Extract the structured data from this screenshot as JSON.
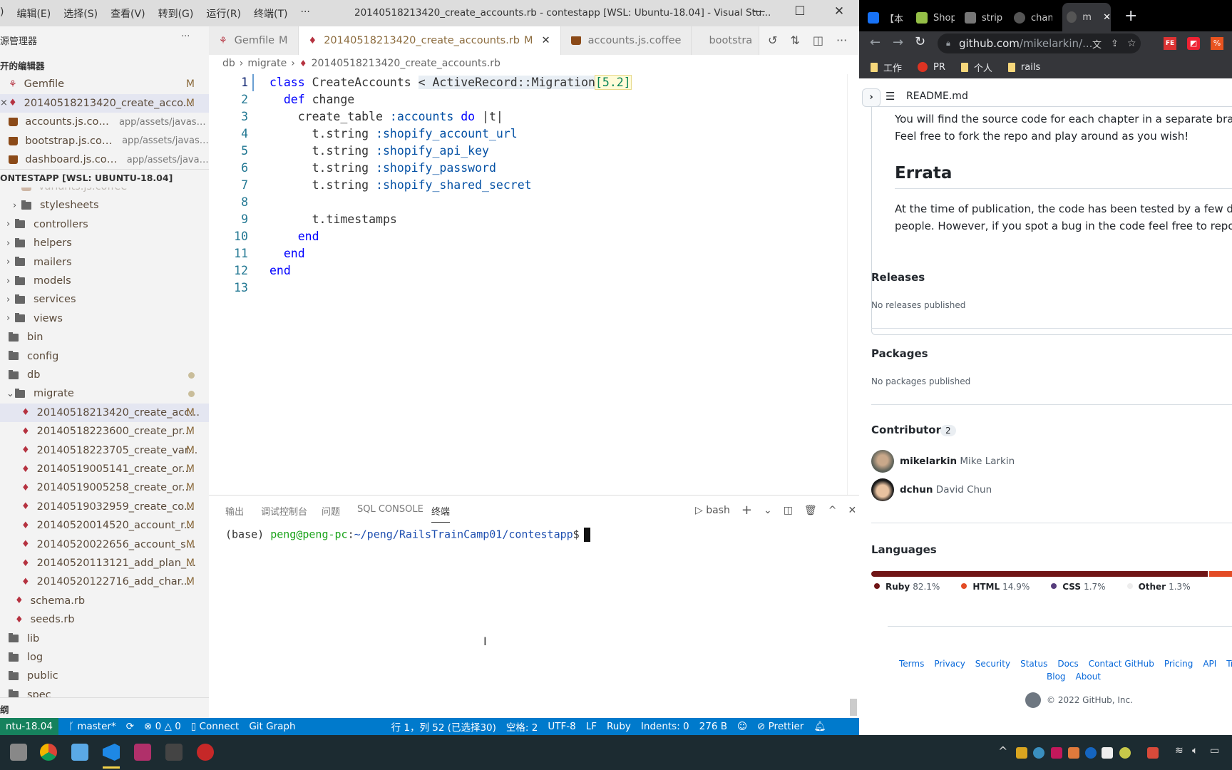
{
  "vscode": {
    "menu": [
      ")",
      "编辑(E)",
      "选择(S)",
      "查看(V)",
      "转到(G)",
      "运行(R)",
      "终端(T)",
      "···"
    ],
    "window_title": "20140518213420_create_accounts.rb - contestapp [WSL: Ubuntu-18.04] - Visual Stu...",
    "window_buttons": {
      "minimize": "—",
      "maximize": "☐",
      "close": "✕"
    },
    "sidebar": {
      "title": "源管理器",
      "more": "···",
      "open_editors_header": "开的编辑器",
      "open_editors": [
        {
          "label": "Gemfile",
          "icon": "gem-icon",
          "badge": "M"
        },
        {
          "label": "20140518213420_create_acco...",
          "icon": "ruby-icon",
          "badge": "M",
          "close": "×",
          "selected": true
        },
        {
          "label": "accounts.js.coffee",
          "icon": "coffee-icon",
          "desc": "app/assets/javascr..."
        },
        {
          "label": "bootstrap.js.coffee",
          "icon": "coffee-icon",
          "desc": "app/assets/javasc..."
        },
        {
          "label": "dashboard.js.coffee",
          "icon": "coffee-icon",
          "desc": "app/assets/javas..."
        }
      ],
      "workspace_header": "ONTESTAPP [WSL: UBUNTU-18.04]",
      "tree": [
        {
          "label": "variants.js.coffee",
          "type": "file",
          "depth": 2,
          "faded": true
        },
        {
          "label": "stylesheets",
          "type": "folder",
          "depth": 2,
          "chevron": ">"
        },
        {
          "label": "controllers",
          "type": "folder",
          "depth": 1,
          "chevron": ">"
        },
        {
          "label": "helpers",
          "type": "folder",
          "depth": 1,
          "chevron": ">"
        },
        {
          "label": "mailers",
          "type": "folder",
          "depth": 1,
          "chevron": ">"
        },
        {
          "label": "models",
          "type": "folder",
          "depth": 1,
          "chevron": ">"
        },
        {
          "label": "services",
          "type": "folder",
          "depth": 1,
          "chevron": ">"
        },
        {
          "label": "views",
          "type": "folder",
          "depth": 1,
          "chevron": ">"
        },
        {
          "label": "bin",
          "type": "folder",
          "depth": 0
        },
        {
          "label": "config",
          "type": "folder",
          "depth": 0
        },
        {
          "label": "db",
          "type": "folder",
          "depth": 0,
          "dot": true
        },
        {
          "label": "migrate",
          "type": "folder",
          "depth": 1,
          "chevron": "v",
          "dot": true
        },
        {
          "label": "20140518213420_create_acc...",
          "type": "ruby",
          "depth": 2,
          "badge": "M",
          "selected": true
        },
        {
          "label": "20140518223600_create_pr...",
          "type": "ruby",
          "depth": 2,
          "badge": "M"
        },
        {
          "label": "20140518223705_create_var...",
          "type": "ruby",
          "depth": 2,
          "badge": "M"
        },
        {
          "label": "20140519005141_create_or...",
          "type": "ruby",
          "depth": 2,
          "badge": "M"
        },
        {
          "label": "20140519005258_create_or...",
          "type": "ruby",
          "depth": 2,
          "badge": "M"
        },
        {
          "label": "20140519032959_create_co...",
          "type": "ruby",
          "depth": 2,
          "badge": "M"
        },
        {
          "label": "20140520014520_account_r...",
          "type": "ruby",
          "depth": 2,
          "badge": "M"
        },
        {
          "label": "20140520022656_account_s...",
          "type": "ruby",
          "depth": 2,
          "badge": "M"
        },
        {
          "label": "20140520113121_add_plan_...",
          "type": "ruby",
          "depth": 2,
          "badge": "M"
        },
        {
          "label": "20140520122716_add_char...",
          "type": "ruby",
          "depth": 2,
          "badge": "M"
        },
        {
          "label": "schema.rb",
          "type": "ruby",
          "depth": 1
        },
        {
          "label": "seeds.rb",
          "type": "ruby",
          "depth": 1
        },
        {
          "label": "lib",
          "type": "folder",
          "depth": 0
        },
        {
          "label": "log",
          "type": "folder",
          "depth": 0
        },
        {
          "label": "public",
          "type": "folder",
          "depth": 0
        },
        {
          "label": "spec",
          "type": "folder",
          "depth": 0
        }
      ],
      "outline_header": "纲"
    },
    "tabs": [
      {
        "label": "Gemfile",
        "badge": "M",
        "icon": "gem-icon"
      },
      {
        "label": "20140518213420_create_accounts.rb",
        "badge": "M",
        "close": "✕",
        "icon": "ruby-icon",
        "active": true
      },
      {
        "label": "accounts.js.coffee",
        "icon": "coffee-icon"
      },
      {
        "label": "bootstra",
        "icon": "coffee-icon"
      }
    ],
    "tab_actions": [
      "↺",
      "⇅",
      "◫",
      "···"
    ],
    "breadcrumb": [
      "db",
      "migrate",
      "20140518213420_create_accounts.rb"
    ],
    "code": [
      [
        [
          "class ",
          "k"
        ],
        [
          "CreateAccounts ",
          "n"
        ],
        [
          "< ActiveRecord::Migration",
          "hl"
        ],
        [
          "[5.2]",
          "num"
        ]
      ],
      [
        [
          "  def ",
          "k"
        ],
        [
          "change",
          "n"
        ]
      ],
      [
        [
          "    create_table ",
          "n"
        ],
        [
          ":accounts ",
          "s"
        ],
        [
          "do ",
          "k"
        ],
        [
          "|t|",
          "n"
        ]
      ],
      [
        [
          "      t.string ",
          "n"
        ],
        [
          ":shopify_account_url",
          "s"
        ]
      ],
      [
        [
          "      t.string ",
          "n"
        ],
        [
          ":shopify_api_key",
          "s"
        ]
      ],
      [
        [
          "      t.string ",
          "n"
        ],
        [
          ":shopify_password",
          "s"
        ]
      ],
      [
        [
          "      t.string ",
          "n"
        ],
        [
          ":shopify_shared_secret",
          "s"
        ]
      ],
      [],
      [
        [
          "      t.timestamps",
          "n"
        ]
      ],
      [
        [
          "    end",
          "k"
        ]
      ],
      [
        [
          "  end",
          "k"
        ]
      ],
      [
        [
          "end",
          "k"
        ]
      ],
      []
    ],
    "panel": {
      "tabs": [
        "输出",
        "调试控制台",
        "问题",
        "SQL CONSOLE",
        "终端"
      ],
      "active_tab": "终端",
      "shell": "bash",
      "actions": [
        "+",
        "⌄",
        "◫",
        "🗑",
        "^",
        "✕"
      ],
      "terminal": {
        "prefix": "(base) ",
        "user": "peng@peng-pc",
        "sep": ":",
        "path": "~/peng/RailsTrainCamp01/contestapp",
        "prompt": "$"
      }
    },
    "status": {
      "remote": "ntu-18.04",
      "branch": "master*",
      "sync": "⟳",
      "errors": "0",
      "warnings": "0",
      "connect": "Connect",
      "git_graph": "Git Graph",
      "position": "行 1，列 52 (已选择30)",
      "spaces": "空格: 2",
      "encoding": "UTF-8",
      "eol": "LF",
      "language": "Ruby",
      "indents": "Indents: 0",
      "size": "276 B",
      "prettier": "Prettier"
    }
  },
  "chrome": {
    "tabs": [
      {
        "label": "【本",
        "icon": "zhihu-icon"
      },
      {
        "label": "Shop",
        "icon": "shopify-icon"
      },
      {
        "label": "strip",
        "icon": "drop-icon"
      },
      {
        "label": "chan",
        "icon": "github-icon"
      },
      {
        "label": "m",
        "icon": "github-icon",
        "active": true,
        "close": "✕"
      }
    ],
    "new_tab": "+",
    "url_host": "github.com",
    "url_path": "/mikelarkin/...",
    "bookmarks": [
      {
        "label": "工作",
        "icon": "folder-icon"
      },
      {
        "label": "PR",
        "icon": "g-icon"
      },
      {
        "label": "个人",
        "icon": "folder-icon"
      },
      {
        "label": "rails",
        "icon": "folder-icon"
      }
    ],
    "extensions": [
      "FE",
      "◩",
      "%"
    ]
  },
  "github": {
    "readme_title": "README.md",
    "readme_lines": [
      "You will find the source code for each chapter in a separate branch.",
      "Feel free to fork the repo and play around as you wish!"
    ],
    "errata_heading": "Errata",
    "errata_lines": [
      "At the time of publication, the code has been tested by a few differ",
      "people. However, if you spot a bug in the code feel free to report it"
    ],
    "releases": {
      "title": "Releases",
      "text": "No releases published"
    },
    "packages": {
      "title": "Packages",
      "text": "No packages published"
    },
    "contributors": {
      "title": "Contributors",
      "count": "2",
      "people": [
        {
          "login": "mikelarkin",
          "name": "Mike Larkin"
        },
        {
          "login": "dchun",
          "name": "David Chun"
        }
      ]
    },
    "languages": {
      "title": "Languages",
      "items": [
        {
          "name": "Ruby",
          "pct": "82.1%",
          "value": 82.1,
          "color": "#701516"
        },
        {
          "name": "HTML",
          "pct": "14.9%",
          "value": 14.9,
          "color": "#e34c26"
        },
        {
          "name": "CSS",
          "pct": "1.7%",
          "value": 1.7,
          "color": "#563d7c"
        },
        {
          "name": "Other",
          "pct": "1.3%",
          "value": 1.3,
          "color": "#ededed"
        }
      ]
    },
    "footer_links": [
      "Terms",
      "Privacy",
      "Security",
      "Status",
      "Docs",
      "Contact GitHub",
      "Pricing",
      "API",
      "Trainin"
    ],
    "footer_links2": [
      "Blog",
      "About"
    ],
    "copyright": "© 2022 GitHub, Inc."
  }
}
